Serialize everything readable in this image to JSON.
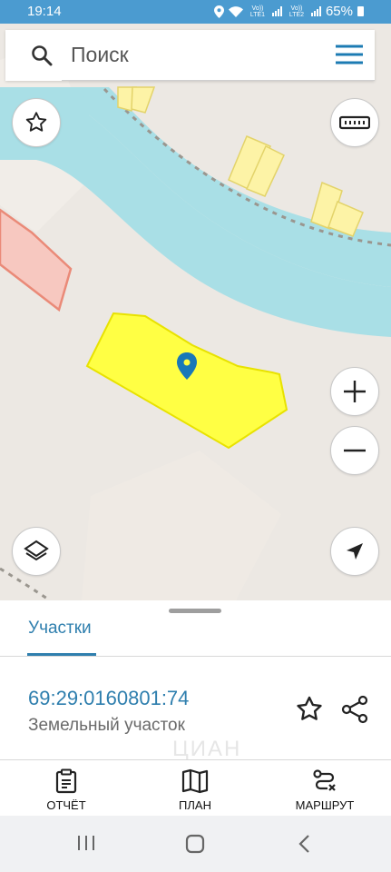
{
  "status": {
    "time": "19:14",
    "carrier1": "Vo)) LTE1",
    "carrier2": "Vo)) LTE2",
    "battery": "65%"
  },
  "search": {
    "placeholder": "Поиск"
  },
  "map": {
    "colors": {
      "water": "#a9dfe6",
      "land": "#ece8e3",
      "parcel": "#ffff44",
      "neighbor": "#f7c8c0",
      "buildings": "#fdf3a6"
    }
  },
  "sheet": {
    "tab_label": "Участки",
    "cadastral_number": "69:29:0160801:74",
    "parcel_type": "Земельный участок",
    "watermark": "ЦИАН"
  },
  "bottom_nav": [
    {
      "label": "ОТЧЁТ",
      "icon": "report-icon"
    },
    {
      "label": "ПЛАН",
      "icon": "map-icon"
    },
    {
      "label": "МАРШРУТ",
      "icon": "route-icon"
    }
  ],
  "accent": "#2f7fae"
}
